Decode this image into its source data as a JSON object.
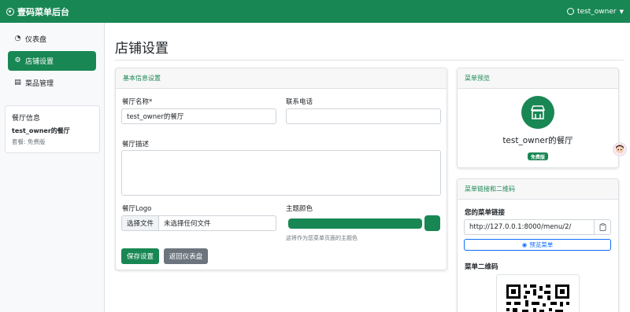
{
  "topbar": {
    "brand": "壹码菜单后台",
    "user": "test_owner"
  },
  "sidebar": {
    "items": [
      {
        "label": "仪表盘",
        "icon": "dashboard-icon"
      },
      {
        "label": "店铺设置",
        "icon": "gear-icon",
        "active": true
      },
      {
        "label": "菜品管理",
        "icon": "dishes-icon"
      }
    ],
    "info": {
      "title": "餐厅信息",
      "name": "test_owner的餐厅",
      "plan": "套餐: 免费版"
    }
  },
  "page": {
    "title": "店铺设置"
  },
  "basic": {
    "header": "基本信息设置",
    "name_label": "餐厅名称*",
    "name_value": "test_owner的餐厅",
    "phone_label": "联系电话",
    "phone_value": "",
    "desc_label": "餐厅描述",
    "desc_value": "",
    "logo_label": "餐厅Logo",
    "file_button": "选择文件",
    "file_text": "未选择任何文件",
    "color_label": "主题颜色",
    "color_value": "#198754",
    "color_help": "这将作为您菜单页面的主题色",
    "save_button": "保存设置",
    "back_button": "返回仪表盘"
  },
  "preview": {
    "header": "菜单预览",
    "shop_name": "test_owner的餐厅",
    "badge": "免费版"
  },
  "link": {
    "header": "菜单链接和二维码",
    "link_title": "您的菜单链接",
    "url": "http://127.0.0.1:8000/menu/2/",
    "preview_button": "预览菜单",
    "qr_title": "菜单二维码"
  },
  "colors": {
    "accent": "#198754",
    "primary": "#0d6efd",
    "secondary": "#6c757d"
  }
}
